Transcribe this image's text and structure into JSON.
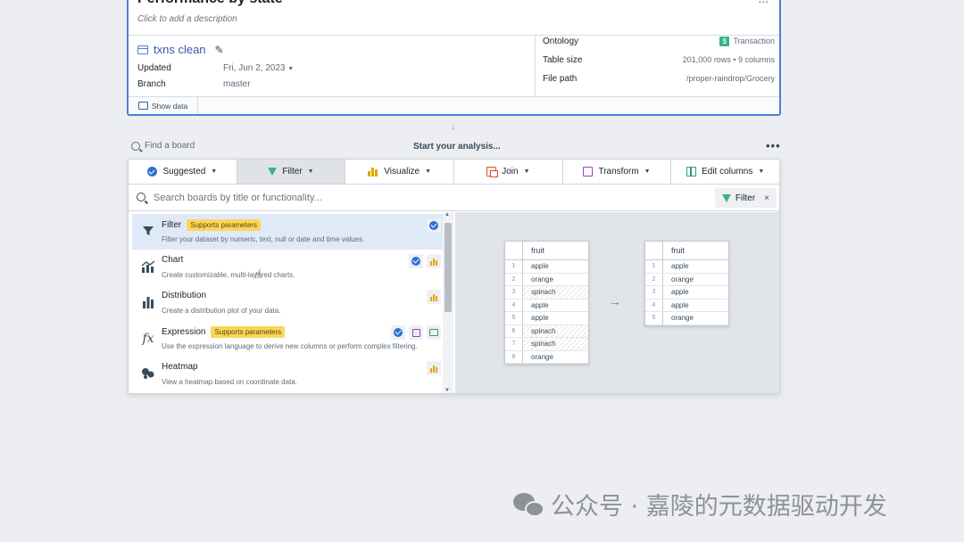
{
  "dataset_card": {
    "title": "Performance by state",
    "description_placeholder": "Click to add a description",
    "name": "txns clean",
    "updated_label": "Updated",
    "updated_value": "Fri, Jun 2, 2023",
    "branch_label": "Branch",
    "branch_value": "master",
    "ontology_label": "Ontology",
    "ontology_value": "Transaction",
    "ontology_badge": "$",
    "table_size_label": "Table size",
    "table_size_value": "201,000 rows • 9 columns",
    "file_path_label": "File path",
    "file_path_value": "/proper-raindrop/Grocery",
    "show_data": "Show data",
    "more": "..."
  },
  "board_header": {
    "find_board": "Find a board",
    "start_analysis": "Start your analysis...",
    "more": "•••"
  },
  "tabs": [
    {
      "label": "Suggested",
      "icon": "circle-check-icon"
    },
    {
      "label": "Filter",
      "icon": "funnel-icon"
    },
    {
      "label": "Visualize",
      "icon": "bar-chart-icon"
    },
    {
      "label": "Join",
      "icon": "join-icon"
    },
    {
      "label": "Transform",
      "icon": "transform-icon"
    },
    {
      "label": "Edit columns",
      "icon": "edit-columns-icon"
    }
  ],
  "search": {
    "placeholder": "Search boards by title or functionality...",
    "filter_chip": "Filter",
    "chip_close": "×"
  },
  "boards": [
    {
      "title": "Filter",
      "badge": "Supports parameters",
      "desc": "Filter your dataset by numeric, text, null or date and time values.",
      "icon": "funnel-icon"
    },
    {
      "title": "Chart",
      "badge": "",
      "desc": "Create customizable, multi-layered charts.",
      "icon": "chart-icon"
    },
    {
      "title": "Distribution",
      "badge": "",
      "desc": "Create a distribution plot of your data.",
      "icon": "bar-chart-icon"
    },
    {
      "title": "Expression",
      "badge": "Supports parameters",
      "desc": "Use the expression language to derive new columns or perform complex filtering.",
      "icon": "fx-icon"
    },
    {
      "title": "Heatmap",
      "badge": "",
      "desc": "View a heatmap based on coordinate data.",
      "icon": "heatmap-icon"
    }
  ],
  "preview": {
    "column": "fruit",
    "before": [
      {
        "n": "1",
        "v": "apple"
      },
      {
        "n": "2",
        "v": "orange"
      },
      {
        "n": "3",
        "v": "spinach"
      },
      {
        "n": "4",
        "v": "apple"
      },
      {
        "n": "5",
        "v": "apple"
      },
      {
        "n": "6",
        "v": "spinach"
      },
      {
        "n": "7",
        "v": "spinach"
      },
      {
        "n": "8",
        "v": "orange"
      }
    ],
    "after": [
      {
        "n": "1",
        "v": "apple"
      },
      {
        "n": "2",
        "v": "orange"
      },
      {
        "n": "3",
        "v": "apple"
      },
      {
        "n": "4",
        "v": "apple"
      },
      {
        "n": "5",
        "v": "orange"
      }
    ],
    "arrow": "→"
  },
  "watermark": "公众号 · 嘉陵的元数据驱动开发",
  "colors": {
    "accent": "#2d72d2",
    "card_border": "#4d80d6",
    "param_badge": "#fbd65a",
    "visualize": "#e0a800",
    "join": "#d94e27",
    "transform": "#9d3fbf",
    "edit": "#2e9e6f",
    "filter": "#3ab384"
  }
}
